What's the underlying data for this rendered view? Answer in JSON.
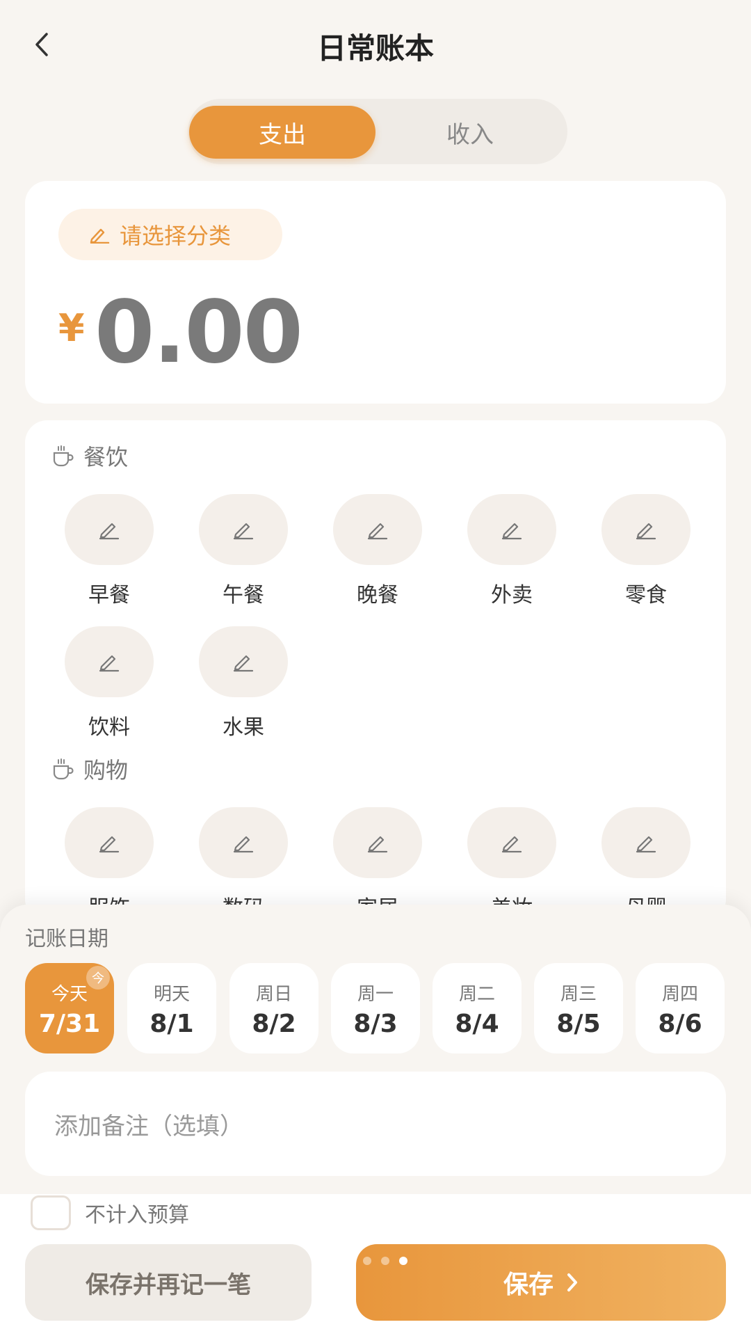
{
  "header": {
    "title": "日常账本"
  },
  "segmented": {
    "expense": "支出",
    "income": "收入"
  },
  "amount_card": {
    "category_placeholder": "请选择分类",
    "currency": "¥",
    "amount": "0.00"
  },
  "categories": {
    "food": {
      "title": "餐饮",
      "items": [
        "早餐",
        "午餐",
        "晚餐",
        "外卖",
        "零食",
        "饮料",
        "水果"
      ]
    },
    "shopping": {
      "title": "购物",
      "items": [
        "服饰",
        "数码",
        "家居",
        "美妆",
        "母婴"
      ]
    }
  },
  "date_section": {
    "label": "记账日期",
    "today_badge": "今",
    "dates": [
      {
        "dow": "今天",
        "md": "7/31"
      },
      {
        "dow": "明天",
        "md": "8/1"
      },
      {
        "dow": "周日",
        "md": "8/2"
      },
      {
        "dow": "周一",
        "md": "8/3"
      },
      {
        "dow": "周二",
        "md": "8/4"
      },
      {
        "dow": "周三",
        "md": "8/5"
      },
      {
        "dow": "周四",
        "md": "8/6"
      }
    ]
  },
  "note": {
    "placeholder": "添加备注（选填）"
  },
  "budget_checkbox": {
    "label": "不计入预算"
  },
  "buttons": {
    "save_again": "保存并再记一笔",
    "save": "保存"
  },
  "colors": {
    "accent": "#e8963c",
    "background": "#f8f5f1"
  },
  "icons": {
    "back": "chevron-left-icon",
    "pencil": "pencil-icon",
    "cup": "coffee-cup-icon"
  }
}
